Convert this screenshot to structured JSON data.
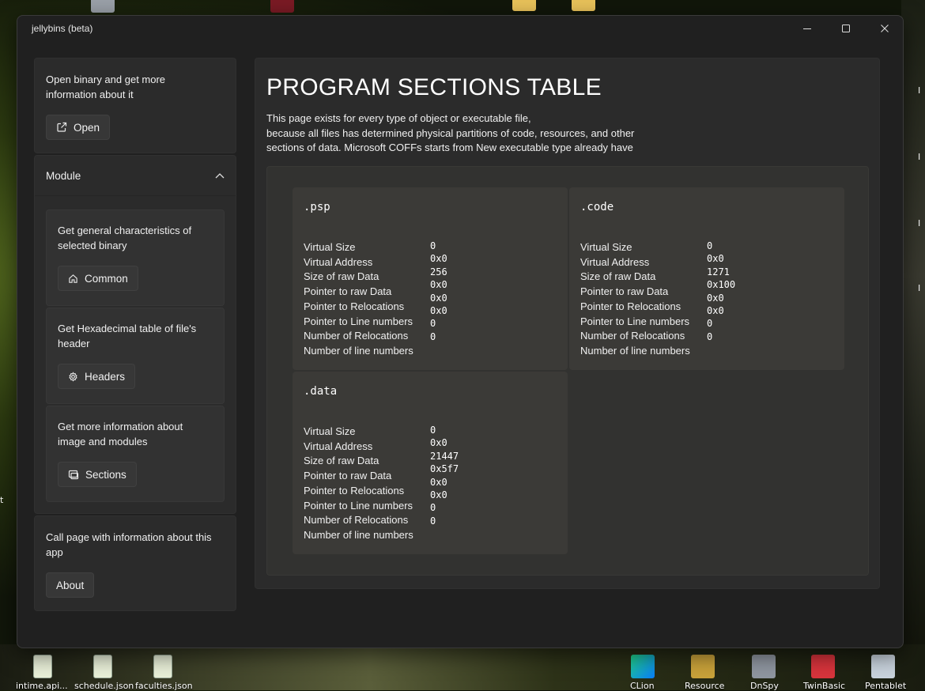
{
  "window": {
    "title": "jellybins (beta)"
  },
  "desktop": {
    "icons": [
      {
        "label": "intime.api..."
      },
      {
        "label": "schedule.json"
      },
      {
        "label": "faculties.json"
      },
      {
        "label": "CLion"
      },
      {
        "label": "Resource"
      },
      {
        "label": "DnSpy"
      },
      {
        "label": "TwinBasic"
      },
      {
        "label": "Pentablet"
      }
    ]
  },
  "sidebar": {
    "open_card": {
      "text": "Open binary and get more information about it",
      "button": "Open",
      "icon": "open-external-icon"
    },
    "module": {
      "label": "Module",
      "items": [
        {
          "text": "Get general characteristics of selected binary",
          "button": "Common",
          "icon": "home-icon"
        },
        {
          "text": "Get Hexadecimal table of file's header",
          "button": "Headers",
          "icon": "gear-icon"
        },
        {
          "text": "Get more information about image and modules",
          "button": "Sections",
          "icon": "sections-icon"
        }
      ]
    },
    "about_card": {
      "text": "Call page with information about this app",
      "button": "About"
    }
  },
  "main": {
    "title": "PROGRAM SECTIONS TABLE",
    "description": "This page exists for every type of object or executable file,\nbecause all files has determined physical partitions of code, resources, and other\nsections of data. Microsoft COFFs starts from New executable type already have",
    "field_labels": [
      "Virtual Size",
      "Virtual Address",
      "Size of raw Data",
      "Pointer to raw Data",
      "Pointer to Relocations",
      "Pointer to Line numbers",
      "Number of Relocations",
      "Number of line numbers"
    ],
    "sections": [
      {
        "name": ".psp",
        "values": [
          "0",
          "0x0",
          "256",
          "0x0",
          "0x0",
          "0x0",
          "0",
          "0"
        ]
      },
      {
        "name": ".code",
        "values": [
          "0",
          "0x0",
          "1271",
          "0x100",
          "0x0",
          "0x0",
          "0",
          "0"
        ]
      },
      {
        "name": ".data",
        "values": [
          "0",
          "0x0",
          "21447",
          "0x5f7",
          "0x0",
          "0x0",
          "0",
          "0"
        ]
      }
    ]
  }
}
